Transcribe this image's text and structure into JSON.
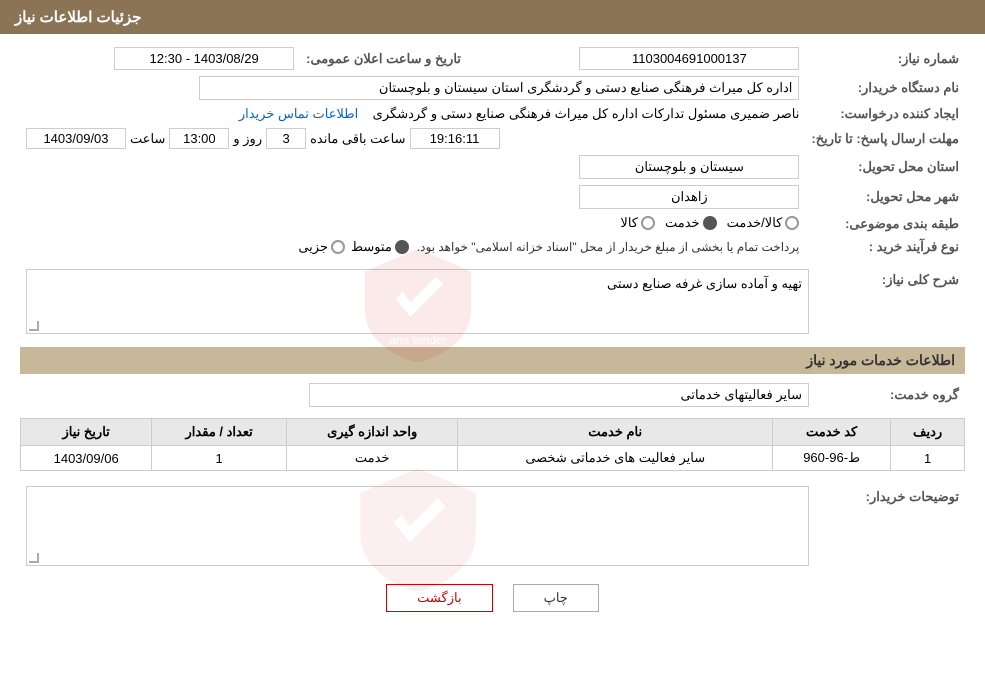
{
  "header": {
    "title": "جزئیات اطلاعات نیاز"
  },
  "fields": {
    "shomara_niaz_label": "شماره نیاز:",
    "shomara_niaz_value": "1103004691000137",
    "nam_dastgah_label": "نام دستگاه خریدار:",
    "nam_dastgah_value": "اداره کل میراث فرهنگی  صنایع دستی و گردشگری استان سیستان و بلوچستان",
    "ijad_konande_label": "ایجاد کننده درخواست:",
    "ijad_konande_value": "ناصر ضمیری مسئول تدارکات اداره کل میراث فرهنگی  صنایع دستی و گردشگری",
    "ijad_konande_link": "اطلاعات تماس خریدار",
    "mohlat_label": "مهلت ارسال پاسخ: تا تاریخ:",
    "mohlat_date": "1403/09/03",
    "mohlat_saat_label": "ساعت",
    "mohlat_saat": "13:00",
    "mohlat_roz_label": "روز و",
    "mohlat_roz": "3",
    "mohlat_baqi_label": "ساعت باقی مانده",
    "mohlat_baqi": "19:16:11",
    "tarikh_label": "تاریخ و ساعت اعلان عمومی:",
    "tarikh_value": "1403/08/29 - 12:30",
    "ostan_label": "استان محل تحویل:",
    "ostan_value": "سیستان و بلوچستان",
    "shahr_label": "شهر محل تحویل:",
    "shahr_value": "زاهدان",
    "tabaghebandi_label": "طبقه بندی موضوعی:",
    "tabaghebandi_kala": "کالا",
    "tabaghebandi_khedmat": "خدمت",
    "tabaghebandi_kala_khedmat": "کالا/خدمت",
    "tabaghebandi_selected": "khedmat",
    "noE_farayand_label": "نوع فرآیند خرید :",
    "noE_farayand_jozei": "جزیی",
    "noE_farayand_motavasset": "متوسط",
    "noE_farayand_desc": "پرداخت تمام یا بخشی از مبلغ خریدار از محل \"اسناد خزانه اسلامی\" خواهد بود.",
    "noE_farayand_selected": "motavasset",
    "sharh_label": "شرح کلی نیاز:",
    "sharh_value": "تهیه و آماده سازی غرفه صنایع دستی",
    "khadamat_label": "اطلاعات خدمات مورد نیاز",
    "grooh_khedmat_label": "گروه خدمت:",
    "grooh_khedmat_value": "سایر فعالیتهای خدماتی",
    "table": {
      "headers": [
        "ردیف",
        "کد خدمت",
        "نام خدمت",
        "واحد اندازه گیری",
        "تعداد / مقدار",
        "تاریخ نیاز"
      ],
      "rows": [
        {
          "radif": "1",
          "code": "ط-96-960",
          "name": "سایر فعالیت های خدماتی شخصی",
          "unit": "خدمت",
          "count": "1",
          "date": "1403/09/06"
        }
      ]
    },
    "tozihat_label": "توضیحات خریدار:",
    "tozihat_value": ""
  },
  "buttons": {
    "print": "چاپ",
    "back": "بازگشت"
  }
}
